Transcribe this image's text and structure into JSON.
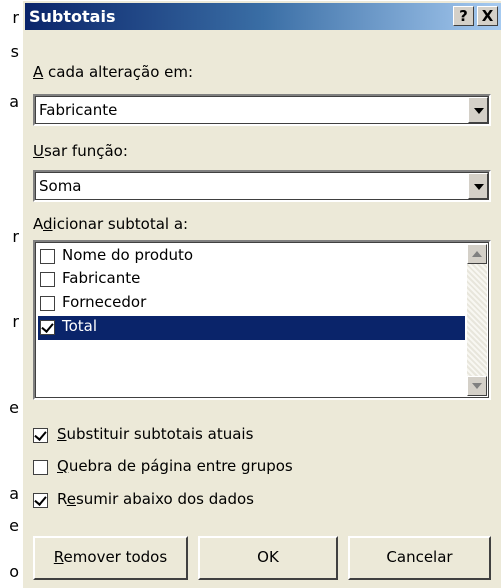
{
  "background_chars": [
    "r",
    "s",
    "a",
    "r",
    "r",
    "e",
    "a",
    "e",
    "o"
  ],
  "dialog": {
    "title": "Subtotais",
    "help_button": "?",
    "close_button": "X"
  },
  "at_each_change": {
    "label_hotkey": "A",
    "label_rest": " cada alteração em:",
    "value": "Fabricante"
  },
  "use_function": {
    "label_hotkey": "U",
    "label_rest": "sar função:",
    "value": "Soma"
  },
  "add_subtotal": {
    "label_pre": "A",
    "label_hotkey": "d",
    "label_rest": "icionar subtotal a:",
    "items": [
      {
        "label": "Nome do produto",
        "checked": false,
        "selected": false
      },
      {
        "label": "Fabricante",
        "checked": false,
        "selected": false
      },
      {
        "label": "Fornecedor",
        "checked": false,
        "selected": false
      },
      {
        "label": "Total",
        "checked": true,
        "selected": true
      }
    ]
  },
  "options": {
    "replace_current": {
      "hotkey": "S",
      "rest": "ubstituir subtotais atuais",
      "checked": true
    },
    "page_break": {
      "hotkey": "Q",
      "rest": "uebra de página entre grupos",
      "checked": false
    },
    "summary_below": {
      "pre": "R",
      "hotkey": "e",
      "rest": "sumir abaixo dos dados",
      "checked": true
    }
  },
  "buttons": {
    "remove_all_hotkey": "R",
    "remove_all_rest": "emover todos",
    "ok": "OK",
    "cancel": "Cancelar"
  },
  "colors": {
    "title_bar": "#0a246a",
    "selection": "#0a246a",
    "dialog_bg": "#ece9d8"
  }
}
